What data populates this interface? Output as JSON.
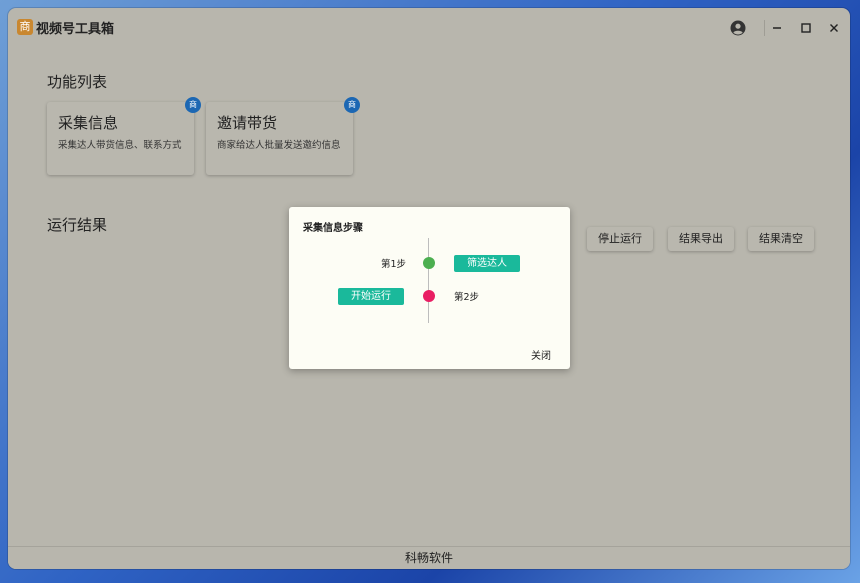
{
  "app": {
    "icon_glyph": "商",
    "title": "视频号工具箱"
  },
  "sections": {
    "functions_title": "功能列表",
    "results_title": "运行结果"
  },
  "cards": [
    {
      "title": "采集信息",
      "desc": "采集达人带货信息、联系方式",
      "badge": "商"
    },
    {
      "title": "邀请带货",
      "desc": "商家给达人批量发送邀约信息",
      "badge": "商"
    }
  ],
  "actions": {
    "stop": "停止运行",
    "export": "结果导出",
    "clear": "结果清空"
  },
  "footer": {
    "text": "科畅软件"
  },
  "dialog": {
    "title": "采集信息步骤",
    "steps": [
      {
        "label": "第1步",
        "button": "筛选达人",
        "color": "#4caf50"
      },
      {
        "label": "第2步",
        "button": "开始运行",
        "color": "#e91e63"
      }
    ],
    "close_label": "关闭"
  },
  "colors": {
    "accent": "#1ab99b",
    "badge": "#1c67b3"
  }
}
